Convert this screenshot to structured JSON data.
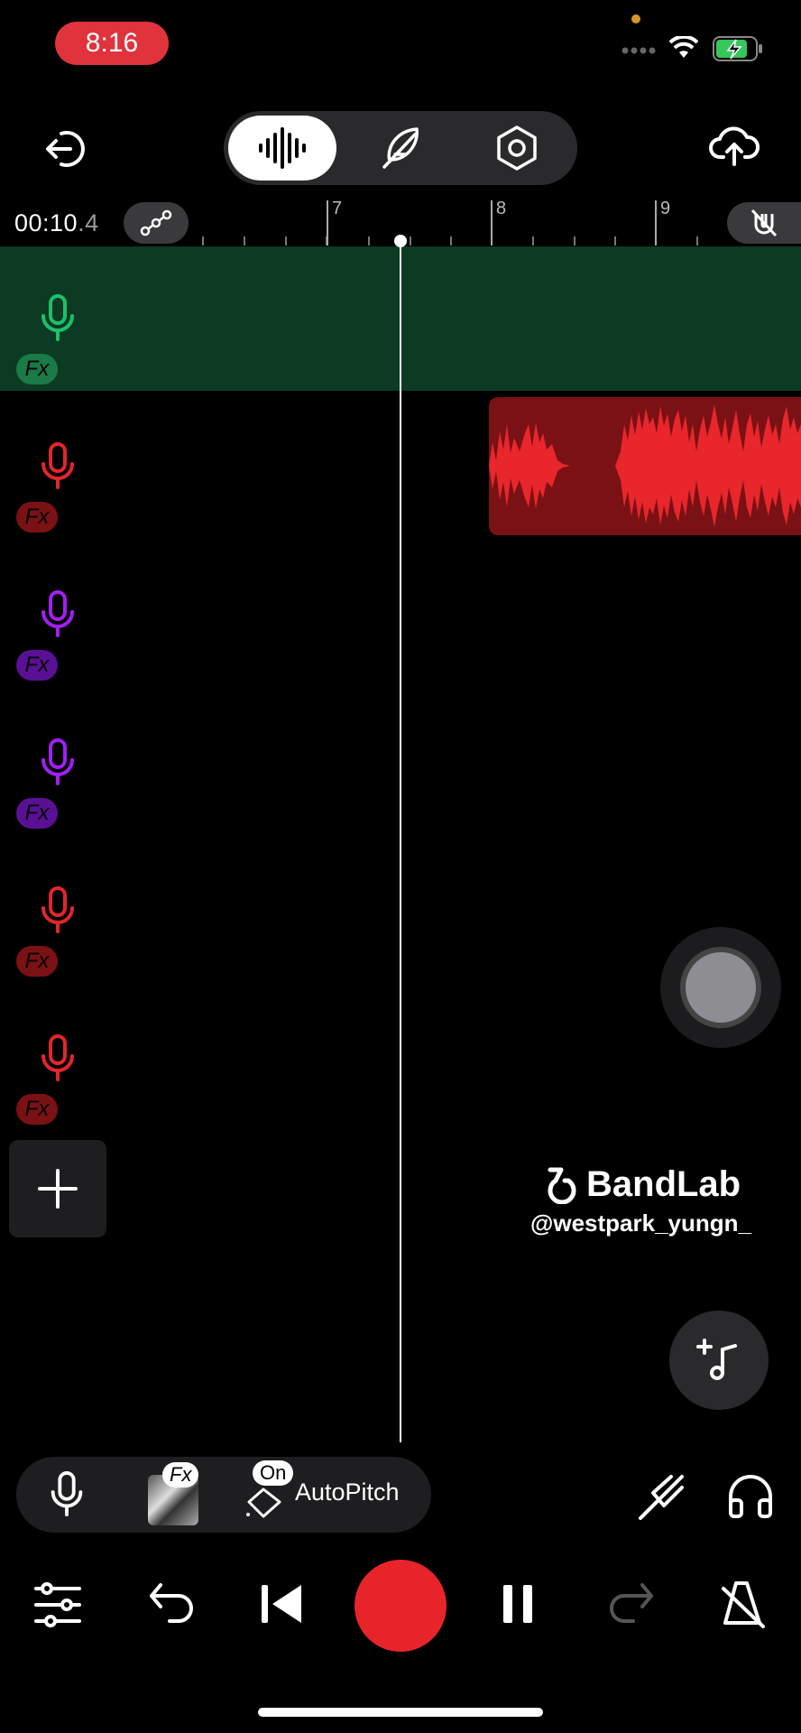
{
  "status_bar": {
    "time": "8:16"
  },
  "toolbar": {
    "back_icon": "exit-icon",
    "modes": [
      {
        "icon": "waveform-icon",
        "active": true
      },
      {
        "icon": "feather-icon",
        "active": false
      },
      {
        "icon": "settings-hex-icon",
        "active": false
      }
    ],
    "upload_icon": "cloud-upload-icon"
  },
  "ruler": {
    "time_main": "00:10",
    "time_frac": ".4",
    "bars": [
      "7",
      "8",
      "9"
    ]
  },
  "tracks": [
    {
      "color": "#1dbf6a",
      "fx_bg": "#1a7a48",
      "fx_label": "Fx",
      "selected": true
    },
    {
      "color": "#e0262c",
      "fx_bg": "#7a1114",
      "fx_label": "Fx",
      "selected": false
    },
    {
      "color": "#a020f0",
      "fx_bg": "#5a1094",
      "fx_label": "Fx",
      "selected": false
    },
    {
      "color": "#a020f0",
      "fx_bg": "#5a1094",
      "fx_label": "Fx",
      "selected": false
    },
    {
      "color": "#e0262c",
      "fx_bg": "#7a1114",
      "fx_label": "Fx",
      "selected": false
    },
    {
      "color": "#e0262c",
      "fx_bg": "#7a1114",
      "fx_label": "Fx",
      "selected": false
    }
  ],
  "watermark": {
    "brand": "BandLab",
    "handle": "@westpark_yungn_"
  },
  "fx_bar": {
    "fx_badge": "Fx",
    "on_badge": "On",
    "autopitch_label": "AutoPitch"
  }
}
